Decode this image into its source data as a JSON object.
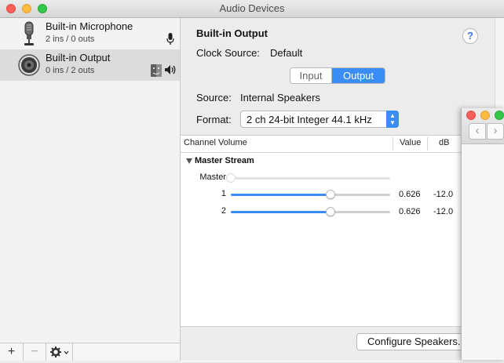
{
  "window": {
    "title": "Audio Devices"
  },
  "sidebar": {
    "devices": [
      {
        "name": "Built-in Microphone",
        "io": "2 ins / 0 outs"
      },
      {
        "name": "Built-in Output",
        "io": "0 ins / 2 outs"
      }
    ]
  },
  "bottombar": {
    "add": "+",
    "remove": "−"
  },
  "detail": {
    "heading": "Built-in Output",
    "help": "?",
    "clock_source_label": "Clock Source:",
    "clock_source_value": "Default",
    "tabs": {
      "input": "Input",
      "output": "Output"
    },
    "source_label": "Source:",
    "source_value": "Internal Speakers",
    "format_label": "Format:",
    "format_value": "2 ch 24-bit Integer 44.1 kHz"
  },
  "table": {
    "headers": {
      "channel_volume": "Channel Volume",
      "value": "Value",
      "db": "dB"
    },
    "stream_name": "Master Stream",
    "rows": [
      {
        "label": "Master",
        "value": "",
        "db": "",
        "level": 0,
        "enabled": false
      },
      {
        "label": "1",
        "value": "0.626",
        "db": "-12.0",
        "level": 0.626,
        "enabled": true
      },
      {
        "label": "2",
        "value": "0.626",
        "db": "-12.0",
        "level": 0.626,
        "enabled": true
      }
    ]
  },
  "footer": {
    "configure_button": "Configure Speakers..."
  },
  "colors": {
    "accent": "#3b8cf5",
    "selected_row": "#dcdcdc"
  }
}
